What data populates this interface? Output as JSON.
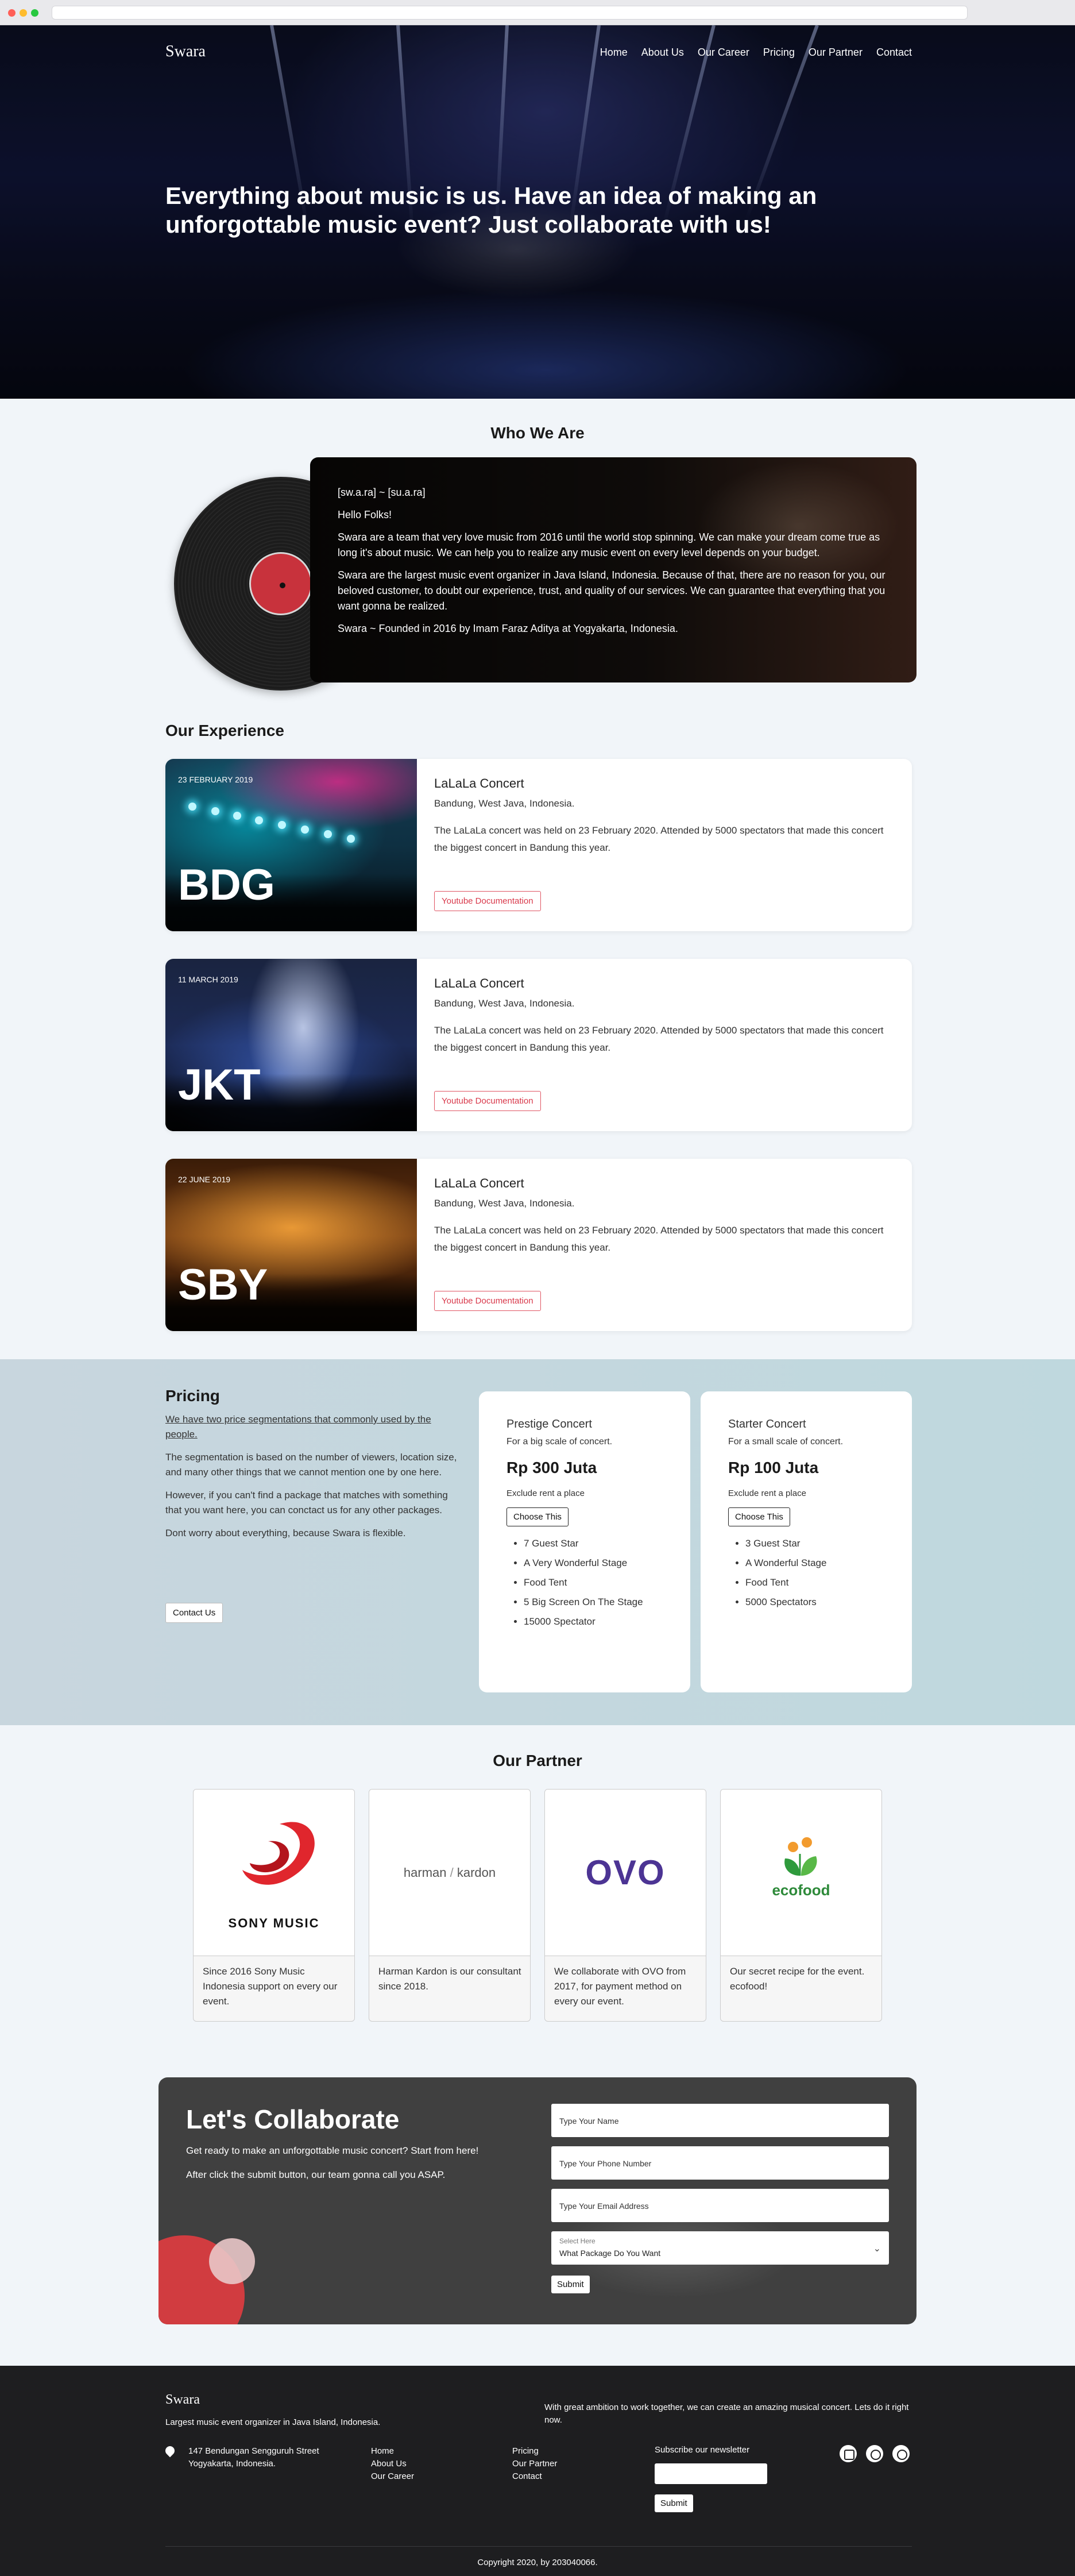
{
  "nav": {
    "brand": "Swara",
    "links": [
      "Home",
      "About Us",
      "Our Career",
      "Pricing",
      "Our Partner",
      "Contact"
    ]
  },
  "hero": {
    "text_pre": "Everything about ",
    "text_bold": "music",
    "text_post": " is us. Have an idea of making an unforgottable music event? Just collaborate with us!"
  },
  "who": {
    "title": "Who We Are",
    "pronounce": "[sw.a.ra] ~ [su.a.ra]",
    "greeting": "Hello Folks!",
    "p1": "Swara are a team that very love music from 2016 until the world stop spinning. We can make your dream come true as long it's about music. We can help you to realize any music event on every level depends on your budget.",
    "p2": "Swara are the largest music event organizer in Java Island, Indonesia. Because of that, there are no reason for you, our beloved customer, to doubt our experience, trust, and quality of our services. We can guarantee that everything that you want gonna be realized.",
    "p3": "Swara ~ Founded in 2016 by Imam Faraz Aditya at Yogyakarta, Indonesia."
  },
  "experience": {
    "title": "Our Experience",
    "items": [
      {
        "date": "23 FEBRUARY 2019",
        "code": "BDG",
        "name": "LaLaLa Concert",
        "location": "Bandung, West Java, Indonesia.",
        "desc": "The LaLaLa concert was held on 23 February 2020. Attended by 5000 spectators that made this concert the biggest concert in Bandung this year.",
        "button": "Youtube Documentation"
      },
      {
        "date": "11 MARCH 2019",
        "code": "JKT",
        "name": "LaLaLa Concert",
        "location": "Bandung, West Java, Indonesia.",
        "desc": "The LaLaLa concert was held on 23 February 2020. Attended by 5000 spectators that made this concert the biggest concert in Bandung this year.",
        "button": "Youtube Documentation"
      },
      {
        "date": "22 JUNE 2019",
        "code": "SBY",
        "name": "LaLaLa Concert",
        "location": "Bandung, West Java, Indonesia.",
        "desc": "The LaLaLa concert was held on 23 February 2020. Attended by 5000 spectators that made this concert the biggest concert in Bandung this year.",
        "button": "Youtube Documentation"
      }
    ]
  },
  "pricing": {
    "title": "Pricing",
    "p1": "We have two price segmentations that commonly used by the people.",
    "p2": "The segmentation is based on the number of viewers, location size, and many other things that we cannot mention one by one here.",
    "p3": "However, if you can't find a package that matches with something that you want here, you can conctact us for any other packages.",
    "p4": "Dont worry about everything, because Swara is flexible.",
    "contact_button": "Contact Us",
    "plans": [
      {
        "name": "Prestige Concert",
        "sub": "For a big scale of concert.",
        "price": "Rp 300 Juta",
        "exclude": "Exclude rent a place",
        "button": "Choose This",
        "features": [
          "7 Guest Star",
          "A Very Wonderful Stage",
          "Food Tent",
          "5 Big Screen On The Stage",
          "15000 Spectator"
        ]
      },
      {
        "name": "Starter Concert",
        "sub": "For a small scale of concert.",
        "price": "Rp 100 Juta",
        "exclude": "Exclude rent a place",
        "button": "Choose This",
        "features": [
          "3 Guest Star",
          "A Wonderful Stage",
          "Food Tent",
          "5000 Spectators"
        ]
      }
    ]
  },
  "partners": {
    "title": "Our Partner",
    "items": [
      {
        "logo_text": "SONY MUSIC",
        "desc": "Since 2016 Sony Music Indonesia support on every our event."
      },
      {
        "logo_text_1": "harman",
        "logo_text_2": "kardon",
        "desc": "Harman Kardon is our consultant since 2018."
      },
      {
        "logo_text": "OVO",
        "desc": "We collaborate with OVO from 2017, for payment method on every our event."
      },
      {
        "logo_text": "ecofood",
        "desc": "Our secret recipe for the event. ecofood!"
      }
    ]
  },
  "collab": {
    "title": "Let's Collaborate",
    "p1": "Get ready to make an unforgottable music concert? Start from here!",
    "p2": "After click the submit button, our team gonna call you ASAP.",
    "name_placeholder": "Type Your Name",
    "phone_placeholder": "Type Your Phone Number",
    "email_placeholder": "Type Your Email Address",
    "select_caption": "Select Here",
    "select_value": "What Package Do You Want",
    "submit": "Submit"
  },
  "footer": {
    "brand": "Swara",
    "tagline": "Largest music event organizer in Java Island, Indonesia.",
    "ambition": "With great ambition to work together, we can create an amazing musical concert. Lets do it right now.",
    "address_1": "147 Bendungan Sengguruh Street",
    "address_2": "Yogyakarta, Indonesia.",
    "col1": [
      "Home",
      "About Us",
      "Our Career"
    ],
    "col2": [
      "Pricing",
      "Our Partner",
      "Contact"
    ],
    "newsletter_title": "Subscribe our newsletter",
    "newsletter_button": "Submit",
    "socials": [
      "youtube-icon",
      "whatsapp-icon",
      "instagram-icon"
    ],
    "copyright": "Copyright 2020, by 203040066."
  }
}
